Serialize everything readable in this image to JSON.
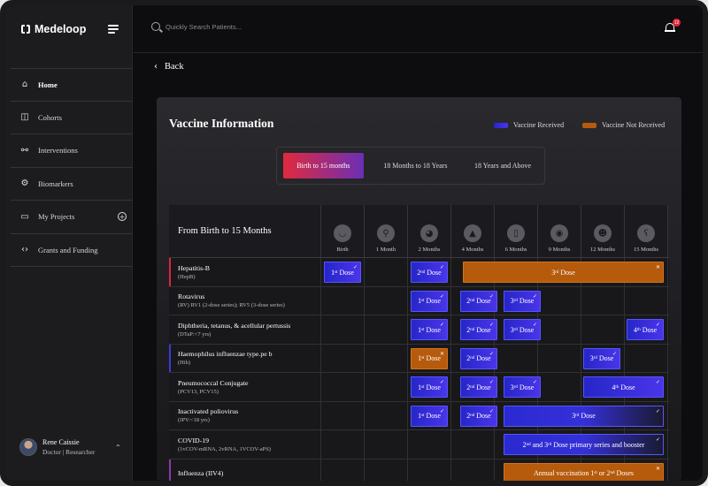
{
  "app": {
    "name": "Medeloop"
  },
  "search": {
    "placeholder": "Quickly Search Patients..."
  },
  "notifications": {
    "count": "12"
  },
  "sidebar": {
    "items": [
      {
        "label": "Home",
        "icon": "home-icon"
      },
      {
        "label": "Cohorts",
        "icon": "cohorts-icon"
      },
      {
        "label": "Interventions",
        "icon": "interventions-icon"
      },
      {
        "label": "Biomarkers",
        "icon": "biomarkers-icon"
      },
      {
        "label": "My Projects",
        "icon": "folder-icon"
      },
      {
        "label": "Grants and Funding",
        "icon": "code-icon"
      }
    ]
  },
  "user": {
    "name": "Rene Caissie",
    "role": "Doctor | Researcher"
  },
  "back": {
    "label": "Back"
  },
  "card": {
    "title": "Vaccine Information",
    "legend": {
      "received": "Vaccine Received",
      "not_received": "Vaccine Not Received"
    },
    "tabs": [
      "Birth to 15 months",
      "18 Months to 18 Years",
      "18 Years and Above"
    ],
    "table_title": "From Birth to 15 Months",
    "ages": [
      "Birth",
      "1 Month",
      "2 Months",
      "4 Months",
      "6 Months",
      "9 Months",
      "12 Months",
      "15 Months"
    ],
    "vaccines": [
      {
        "name": "Hepatitis-B",
        "sub": "(HepB)"
      },
      {
        "name": "Rotavirus",
        "sub": "(RV) RV1 (2-dose series); RV5 (3-dose series)"
      },
      {
        "name": "Diphtheria, tetanus, & acellular pertussis",
        "sub": "(DTaP:<7 yrs)"
      },
      {
        "name": "Haemophilus influenzae type.pe b",
        "sub": "(Hib)"
      },
      {
        "name": "Pneumococcal Conjugate",
        "sub": "(PCV13, PCV15)"
      },
      {
        "name": "Inactivated poliovirus",
        "sub": "(IPV:<18 yrs)"
      },
      {
        "name": "COVID-19",
        "sub": "(1vCOV-mRNA, 2vRNA, 1VCOV-aPS)"
      },
      {
        "name": "Influenza (IIV4)",
        "sub": ""
      }
    ]
  },
  "colors": {
    "received": "#2d2dd4",
    "not_received": "#b65a0c",
    "tab_gradient_start": "#e02a3e",
    "tab_gradient_end": "#6b2fb5"
  }
}
